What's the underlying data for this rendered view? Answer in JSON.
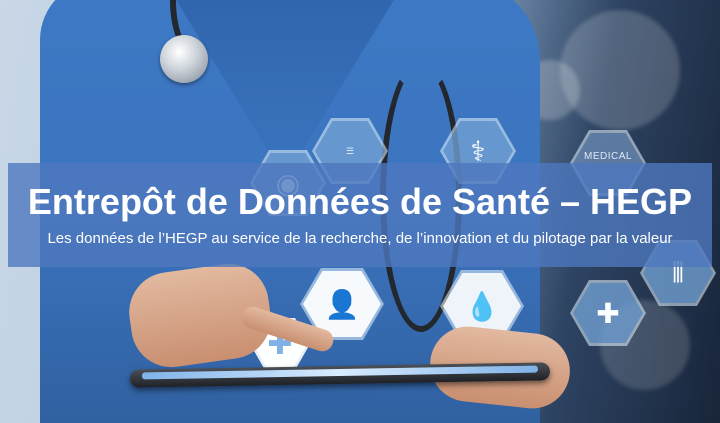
{
  "banner": {
    "title": "Entrepôt de Données de Santé – HEGP",
    "subtitle": "Les données de l’HEGP au service de la recherche, de l’innovation et du pilotage par la valeur"
  },
  "hud": {
    "medical_label": "MEDICAL",
    "icons": [
      "patient-icon",
      "blood-drops-icon",
      "medical-cross-icon",
      "first-aid-kit-icon",
      "eye-icon",
      "doctor-icon",
      "test-tubes-icon",
      "document-icon"
    ]
  },
  "colors": {
    "banner_background": "#4d78be",
    "banner_text": "#ffffff",
    "scrubs": "#3d79c5"
  }
}
